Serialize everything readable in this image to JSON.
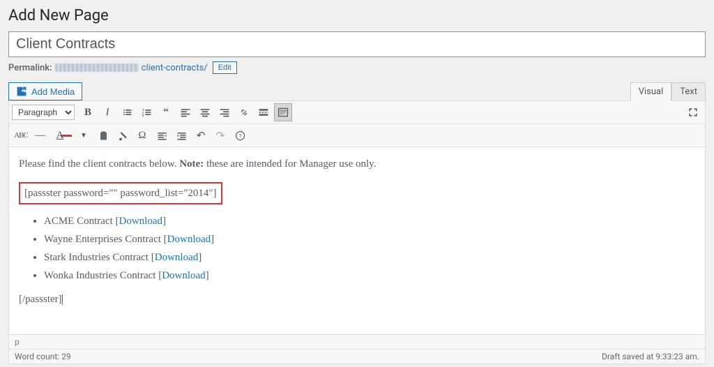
{
  "header": {
    "title": "Add New Page"
  },
  "post": {
    "title_value": "Client Contracts"
  },
  "permalink": {
    "label": "Permalink:",
    "slug": "client-contracts/",
    "edit_label": "Edit"
  },
  "toolbar": {
    "add_media_label": "Add Media"
  },
  "tabs": {
    "visual": "Visual",
    "text": "Text"
  },
  "format_select": {
    "value": "Paragraph"
  },
  "content": {
    "intro_before": "Please find the client contracts below. ",
    "note_label": "Note:",
    "intro_after": " these are intended for Manager use only.",
    "shortcode_open": "[passster password=\"\" password_list=\"2014\"]",
    "items": [
      {
        "text": "ACME Contract ",
        "dl": "Download"
      },
      {
        "text": "Wayne Enterprises Contract ",
        "dl": "Download"
      },
      {
        "text": "Stark Industries Contract ",
        "dl": "Download"
      },
      {
        "text": "Wonka Industries Contract ",
        "dl": "Download"
      }
    ],
    "shortcode_close": "[/passster]"
  },
  "status": {
    "path": "p",
    "wordcount_label": "Word count: ",
    "wordcount_value": "29",
    "draft_saved": "Draft saved at 9:33:23 am."
  }
}
